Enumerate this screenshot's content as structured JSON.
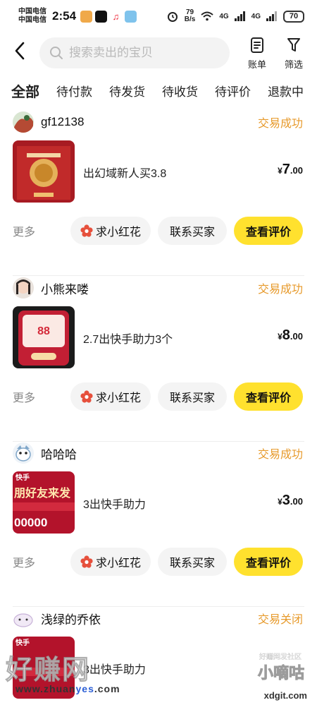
{
  "status_bar": {
    "carrier1": "中国电信",
    "carrier2": "中国电信",
    "time": "2:54",
    "net_speed_value": "79",
    "net_speed_unit": "B/s",
    "signal1": "4G",
    "signal2": "4G",
    "battery": "70"
  },
  "header": {
    "back_icon": "chevron-left-icon",
    "search_placeholder": "搜索卖出的宝贝",
    "bill_label": "账单",
    "filter_label": "筛选"
  },
  "tabs": [
    {
      "label": "全部",
      "active": true
    },
    {
      "label": "待付款",
      "active": false
    },
    {
      "label": "待发货",
      "active": false
    },
    {
      "label": "待收货",
      "active": false
    },
    {
      "label": "待评价",
      "active": false
    },
    {
      "label": "退款中",
      "active": false
    }
  ],
  "orders": [
    {
      "seller": "gf12138",
      "status": "交易成功",
      "title": "出幻域新人买3.8",
      "price_currency": "¥",
      "price_int": "7",
      "price_dec": ".00",
      "more": "更多",
      "btn_flower": "求小红花",
      "btn_contact": "联系买家",
      "btn_review": "查看评价"
    },
    {
      "seller": "小熊来喽",
      "status": "交易成功",
      "title": "2.7出快手助力3个",
      "price_currency": "¥",
      "price_int": "8",
      "price_dec": ".00",
      "thumb_value": "88",
      "more": "更多",
      "btn_flower": "求小红花",
      "btn_contact": "联系买家",
      "btn_review": "查看评价"
    },
    {
      "seller": "哈哈哈",
      "status": "交易成功",
      "title": "3出快手助力",
      "price_currency": "¥",
      "price_int": "3",
      "price_dec": ".00",
      "thumb_brand": "快手",
      "thumb_line": "朋好友来发",
      "thumb_amount": "00000",
      "more": "更多",
      "btn_flower": "求小红花",
      "btn_contact": "联系买家",
      "btn_review": "查看评价"
    },
    {
      "seller": "浅绿的乔依",
      "status": "交易关闭",
      "title": "3出快手助力",
      "thumb_brand": "快手"
    }
  ],
  "watermark": {
    "left_text": "好赚网",
    "url_prefix": "www.",
    "url_mid": "zhuan",
    "url_accent": "yes",
    "url_suffix": ".com",
    "right_text": "小嘀咕",
    "right_small": "好赚网发社区",
    "right_domain": "xdgit.com"
  },
  "colors": {
    "accent_yellow": "#ffe12e",
    "status_orange": "#e79a2b",
    "thumb_red": "#b3132b"
  }
}
